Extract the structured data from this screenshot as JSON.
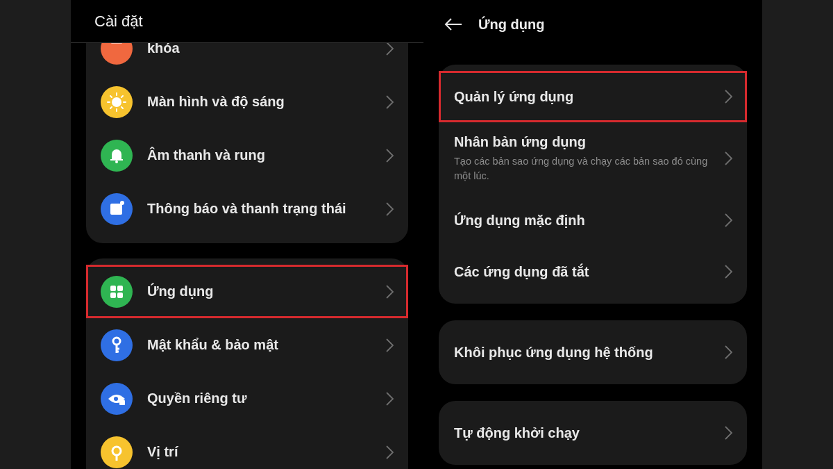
{
  "left_screen": {
    "title": "Cài đặt",
    "groups": [
      {
        "items": [
          {
            "label": "khóa",
            "color": "#f0683f",
            "highlighted": false
          },
          {
            "label": "Màn hình và độ sáng",
            "color": "#f7c32e",
            "highlighted": false
          },
          {
            "label": "Âm thanh và rung",
            "color": "#2fb552",
            "highlighted": false
          },
          {
            "label": "Thông báo và thanh trạng thái",
            "color": "#2f6fe4",
            "highlighted": false
          }
        ]
      },
      {
        "items": [
          {
            "label": "Ứng dụng",
            "color": "#2fb552",
            "highlighted": true
          },
          {
            "label": "Mật khẩu & bảo mật",
            "color": "#2f6fe4",
            "highlighted": false
          },
          {
            "label": "Quyền riêng tư",
            "color": "#2f6fe4",
            "highlighted": false
          },
          {
            "label": "Vị trí",
            "color": "#f7c32e",
            "highlighted": false
          }
        ]
      }
    ]
  },
  "right_screen": {
    "title": "Ứng dụng",
    "groups": [
      {
        "items": [
          {
            "label": "Quản lý ứng dụng",
            "highlighted": true
          },
          {
            "label": "Nhân bản ứng dụng",
            "description": "Tạo các bản sao ứng dụng và chạy các bản sao đó cùng một lúc.",
            "highlighted": false
          },
          {
            "label": "Ứng dụng mặc định",
            "highlighted": false
          },
          {
            "label": "Các ứng dụng đã tắt",
            "highlighted": false
          }
        ]
      },
      {
        "items": [
          {
            "label": "Khôi phục ứng dụng hệ thống",
            "highlighted": false
          }
        ]
      },
      {
        "items": [
          {
            "label": "Tự động khởi chạy",
            "highlighted": false
          }
        ]
      }
    ]
  }
}
